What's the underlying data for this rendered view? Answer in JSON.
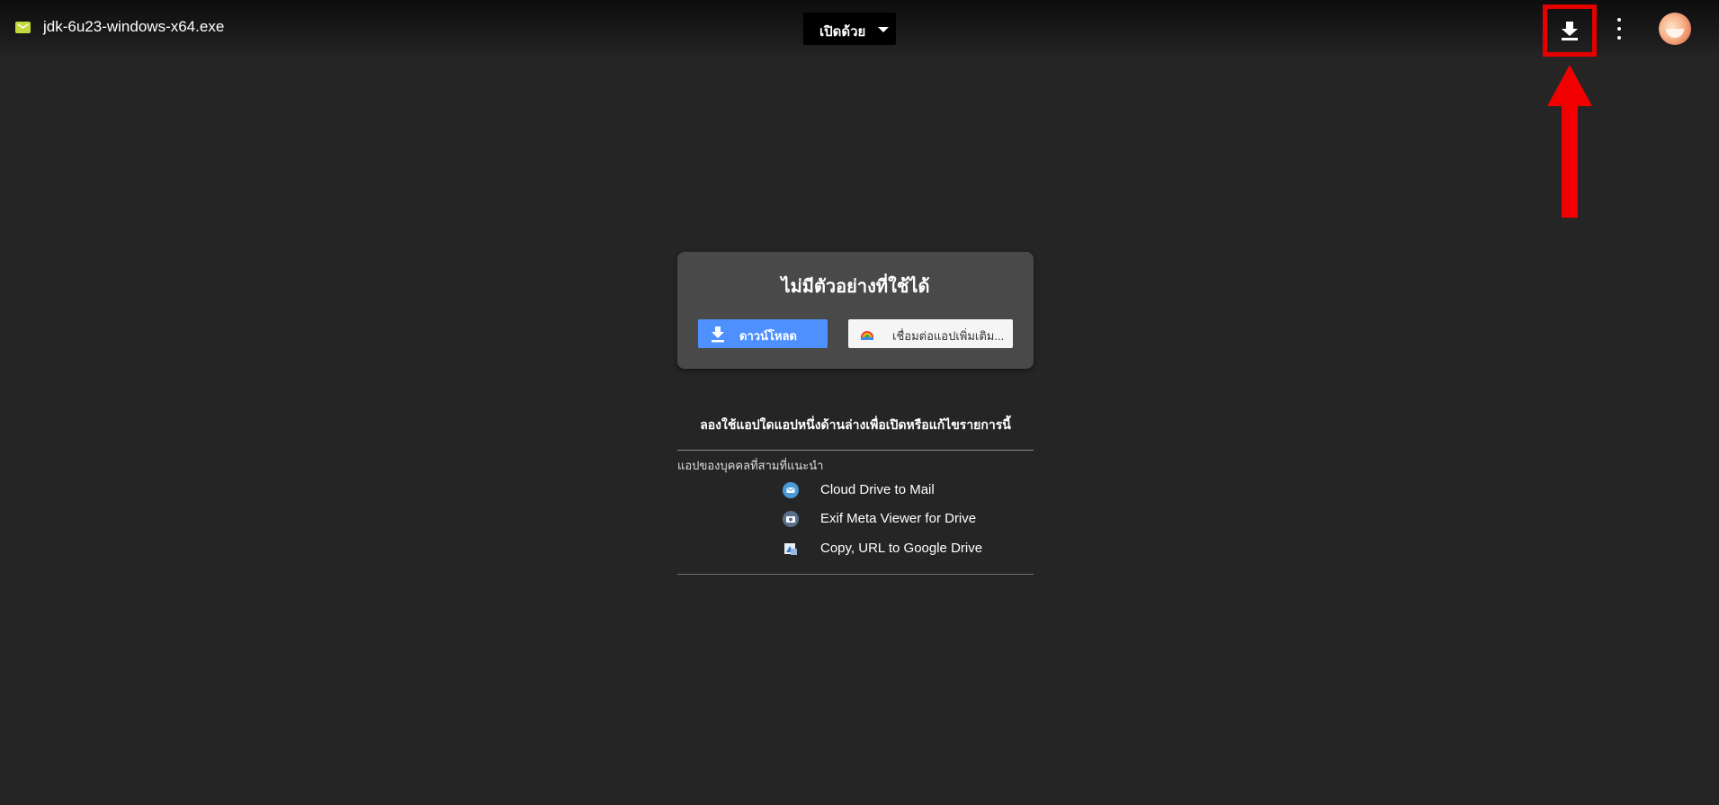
{
  "header": {
    "file_name": "jdk-6u23-windows-x64.exe",
    "open_with_label": "เปิดด้วย",
    "download_icon": "download-icon",
    "more_icon": "more-vert-icon",
    "avatar": "user-avatar"
  },
  "preview_card": {
    "title": "ไม่มีตัวอย่างที่ใช้ได้",
    "download_label": "ดาวน์โหลด",
    "connect_label": "เชื่อมต่อแอปเพิ่มเติม..."
  },
  "suggestions": {
    "heading": "ลองใช้แอปใดแอปหนึ่งด้านล่างเพื่อเปิดหรือแก้ไขรายการนี้",
    "section_label": "แอปของบุคคลที่สามที่แนะนำ",
    "apps": [
      {
        "label": "Cloud Drive to Mail",
        "icon": "mail-icon",
        "color": "#4a9ad8"
      },
      {
        "label": "Exif Meta Viewer for Drive",
        "icon": "camera-icon",
        "color": "#5a6f8c"
      },
      {
        "label": "Copy, URL to Google Drive",
        "icon": "drive-copy-icon",
        "color": "#3a7fc1"
      }
    ]
  },
  "colors": {
    "background": "#252525",
    "primary_button": "#4d90fe",
    "annotation": "#e50000",
    "file_icon": "#c4d93c"
  }
}
